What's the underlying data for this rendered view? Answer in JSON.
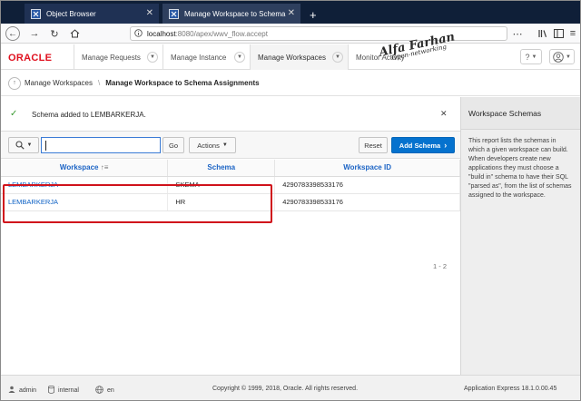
{
  "browser": {
    "tabs": [
      {
        "title": "Object Browser",
        "close": "✕"
      },
      {
        "title": "Manage Workspace to Schema",
        "close": "✕"
      }
    ],
    "new_tab": "+",
    "url_host": "localhost",
    "url_path": ":8080/apex/wwv_flow.accept"
  },
  "apex": {
    "logo": "ORACLE",
    "menu": [
      {
        "label": "Manage Requests"
      },
      {
        "label": "Manage Instance"
      },
      {
        "label": "Manage Workspaces"
      },
      {
        "label": "Monitor Activity"
      }
    ],
    "watermark_line1": "Alfa Farhan",
    "watermark_line2": "Open-networking"
  },
  "breadcrumb": {
    "parent": "Manage Workspaces",
    "separator": "\\",
    "current": "Manage Workspace to Schema Assignments"
  },
  "success": {
    "message": "Schema added to LEMBARKERJA.",
    "close": "✕"
  },
  "toolbar": {
    "search_value": "",
    "go": "Go",
    "actions": "Actions",
    "reset": "Reset",
    "add_schema": "Add Schema"
  },
  "grid": {
    "columns": [
      "Workspace",
      "Schema",
      "Workspace ID"
    ],
    "rows": [
      [
        "LEMBARKERJA",
        "SKEMA",
        "4290783398533176"
      ],
      [
        "LEMBARKERJA",
        "HR",
        "4290783398533176"
      ]
    ],
    "pagination": "1 - 2"
  },
  "sidebar": {
    "title": "Workspace Schemas",
    "text": "This report lists the schemas in which a given workspace can build. When developers create new applications they must choose a \"build in\" schema to have their SQL \"parsed as\", from the list of schemas assigned to the workspace."
  },
  "footer": {
    "user": "admin",
    "schema": "internal",
    "lang": "en",
    "copyright": "Copyright © 1999, 2018, Oracle. All rights reserved.",
    "version": "Application Express 18.1.0.00.45"
  },
  "colors": {
    "accent": "#0572ce",
    "oracle_red": "#e0111f",
    "success_green": "#3b9a32",
    "highlight": "#d0121b"
  }
}
